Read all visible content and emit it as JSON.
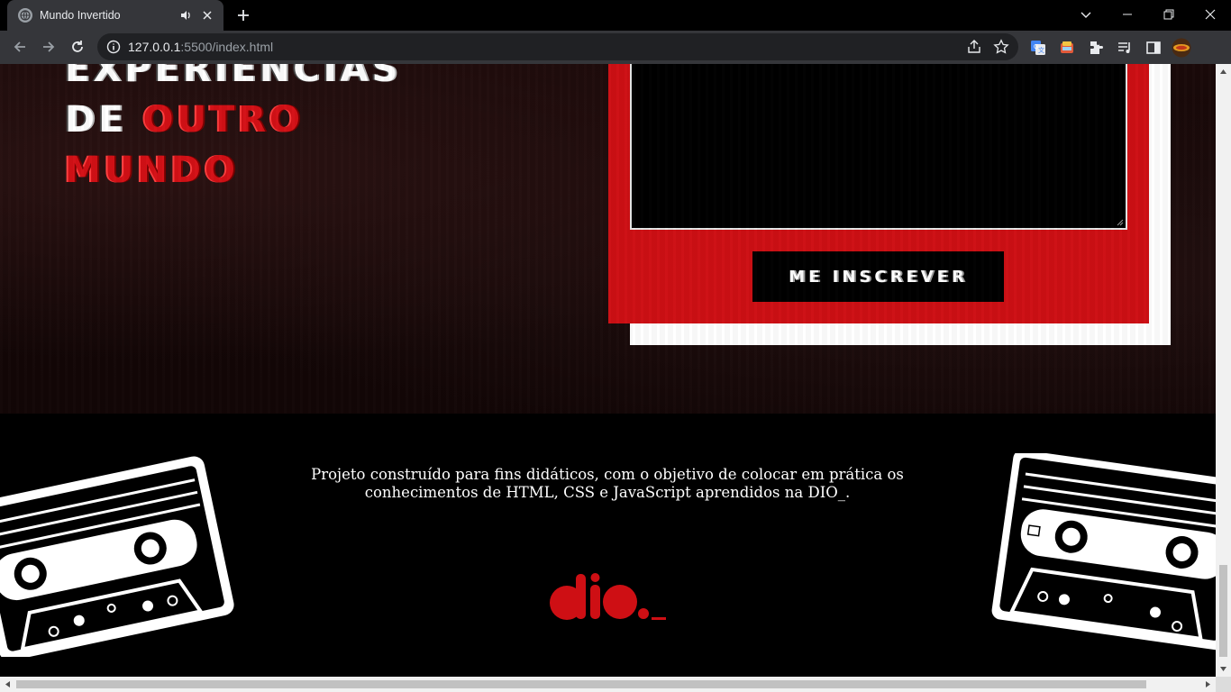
{
  "browser": {
    "tab_title": "Mundo Invertido",
    "url_host": "127.0.0.1",
    "url_rest": ":5500/index.html"
  },
  "hero": {
    "headline_line1": "EXPERIÊNCIAS",
    "headline_de": "DE",
    "headline_outro": "OUTRO",
    "headline_mundo": "MUNDO"
  },
  "form": {
    "submit_label": "ME INSCREVER"
  },
  "footer": {
    "text_line1": "Projeto construído para fins didáticos, com o objetivo de colocar em prática os",
    "text_line2": "conhecimentos de HTML, CSS e JavaScript aprendidos na DIO_.",
    "logo_text": "dio._"
  },
  "colors": {
    "accent_red": "#ce0f14",
    "form_shadow": "#ffffff",
    "footer_bg": "#000000",
    "chrome_toolbar": "#35363a"
  },
  "icons": [
    "globe-icon",
    "speaker-icon",
    "close-icon",
    "plus-icon",
    "chevron-down-icon",
    "minimize-icon",
    "restore-icon",
    "back-icon",
    "forward-icon",
    "reload-icon",
    "info-icon",
    "share-icon",
    "star-icon",
    "translate-icon",
    "extension-icon",
    "puzzle-icon",
    "media-icon",
    "sidepanel-icon",
    "profile-icon"
  ]
}
